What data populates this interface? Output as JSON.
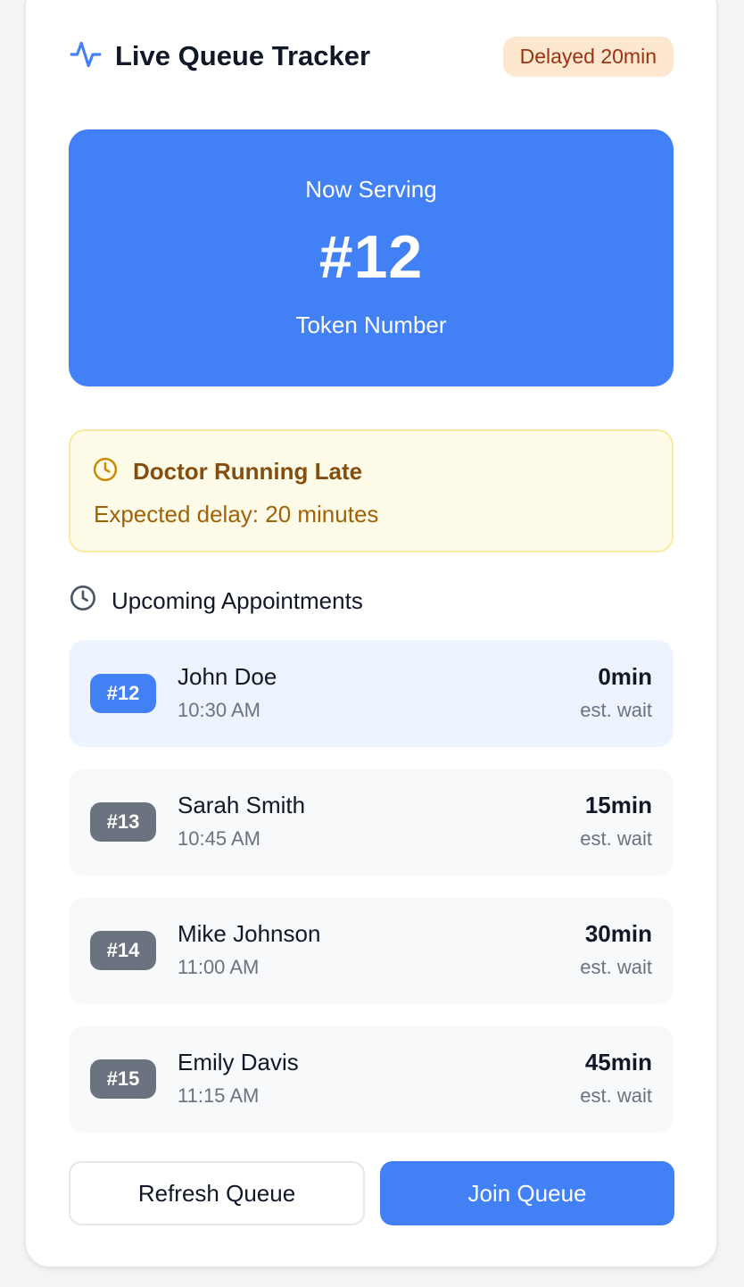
{
  "header": {
    "title": "Live Queue Tracker",
    "icon": "activity-icon",
    "status_badge": "Delayed 20min",
    "accent": "#4280f5"
  },
  "now_serving": {
    "label": "Now Serving",
    "number": "#12",
    "sublabel": "Token Number"
  },
  "alert": {
    "icon": "clock-icon",
    "title": "Doctor Running Late",
    "message": "Expected delay: 20 minutes"
  },
  "upcoming": {
    "icon": "clock-icon",
    "title": "Upcoming Appointments",
    "items": [
      {
        "token": "#12",
        "name": "John Doe",
        "time": "10:30 AM",
        "wait": "0min",
        "wait_label": "est. wait",
        "active": true
      },
      {
        "token": "#13",
        "name": "Sarah Smith",
        "time": "10:45 AM",
        "wait": "15min",
        "wait_label": "est. wait",
        "active": false
      },
      {
        "token": "#14",
        "name": "Mike Johnson",
        "time": "11:00 AM",
        "wait": "30min",
        "wait_label": "est. wait",
        "active": false
      },
      {
        "token": "#15",
        "name": "Emily Davis",
        "time": "11:15 AM",
        "wait": "45min",
        "wait_label": "est. wait",
        "active": false
      }
    ]
  },
  "actions": {
    "refresh_label": "Refresh Queue",
    "join_label": "Join Queue"
  }
}
